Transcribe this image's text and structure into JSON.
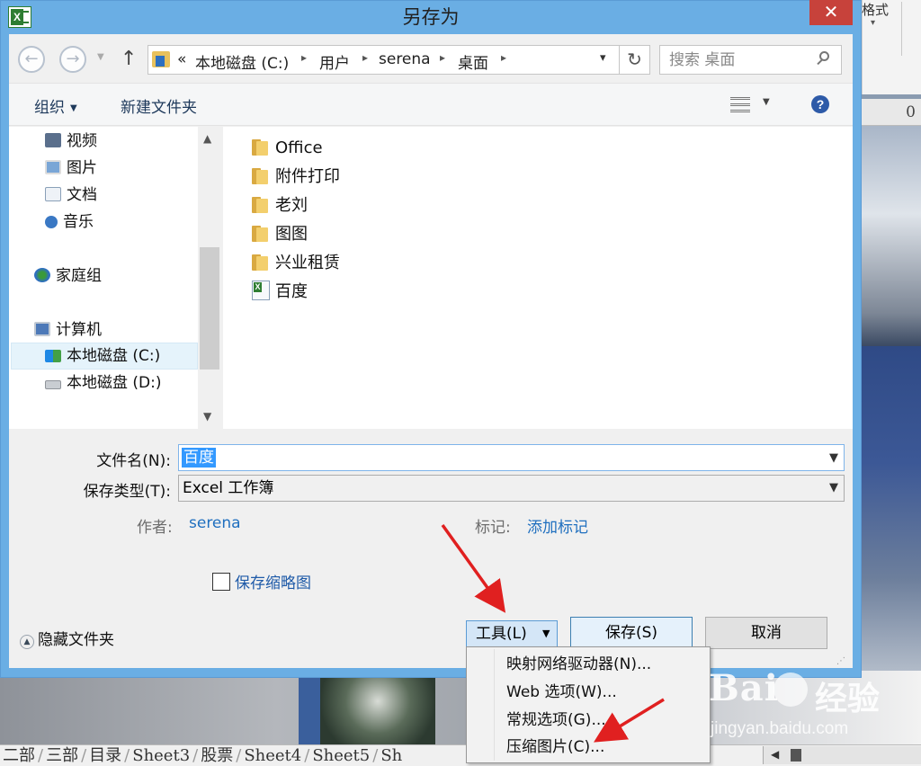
{
  "dialog": {
    "title": "另存为",
    "close_label": "✕"
  },
  "background": {
    "ribbon_text": "格式",
    "column_header": "0",
    "sheet_tabs": [
      "二部",
      "三部",
      "目录",
      "Sheet3",
      "股票",
      "Sheet4",
      "Sheet5",
      "Sh"
    ]
  },
  "address_bar": {
    "overflow": "«",
    "crumbs": [
      "本地磁盘 (C:)",
      "用户",
      "serena",
      "桌面"
    ],
    "search_placeholder": "搜索 桌面"
  },
  "commandbar": {
    "organize_label": "组织",
    "new_folder_label": "新建文件夹",
    "help_label": "?"
  },
  "nav_pane": {
    "items": [
      {
        "label": "视频",
        "icon": "video-icon"
      },
      {
        "label": "图片",
        "icon": "pictures-icon"
      },
      {
        "label": "文档",
        "icon": "documents-icon"
      },
      {
        "label": "音乐",
        "icon": "music-icon"
      },
      {
        "label": "家庭组",
        "icon": "homegroup-icon"
      },
      {
        "label": "计算机",
        "icon": "computer-icon"
      },
      {
        "label": "本地磁盘 (C:)",
        "icon": "drive-c-icon",
        "selected": true
      },
      {
        "label": "本地磁盘 (D:)",
        "icon": "drive-d-icon"
      }
    ]
  },
  "files": [
    {
      "name": "Office",
      "type": "folder"
    },
    {
      "name": "附件打印",
      "type": "folder"
    },
    {
      "name": "老刘",
      "type": "folder"
    },
    {
      "name": "图图",
      "type": "folder"
    },
    {
      "name": "兴业租赁",
      "type": "folder"
    },
    {
      "name": "百度",
      "type": "excel"
    }
  ],
  "form": {
    "filename_label": "文件名(N):",
    "filename_value": "百度",
    "filetype_label": "保存类型(T):",
    "filetype_value": "Excel 工作簿",
    "author_label": "作者:",
    "author_value": "serena",
    "tags_label": "标记:",
    "tags_value": "添加标记",
    "thumbnail_label": "保存缩略图",
    "thumbnail_checked": false
  },
  "footer": {
    "hide_folders_label": "隐藏文件夹",
    "tools_label": "工具(L)",
    "save_label": "保存(S)",
    "cancel_label": "取消"
  },
  "tools_menu": {
    "items": [
      "映射网络驱动器(N)...",
      "Web 选项(W)...",
      "常规选项(G)...",
      "压缩图片(C)..."
    ]
  },
  "watermark": {
    "logo_text": "Bai",
    "cn_text": "经验",
    "url": "jingyan.baidu.com"
  },
  "colors": {
    "titlebar": "#6aaee4",
    "close_button": "#c7423b",
    "selection": "#3399ff",
    "annotation_arrow": "#e02020"
  }
}
